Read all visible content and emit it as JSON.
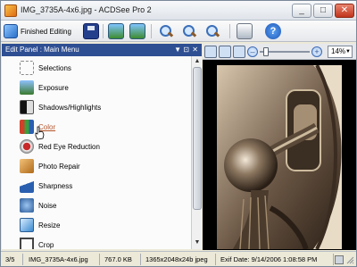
{
  "window": {
    "title": "IMG_3735A-4x6.jpg - ACDSee Pro 2"
  },
  "titlebar": {
    "minimize": "_",
    "maximize": "□",
    "close": "✕"
  },
  "toolbar": {
    "finished_label": "Finished Editing"
  },
  "panel": {
    "title": "Edit Panel : Main Menu",
    "pin": "▼ ⊡",
    "close": "✕"
  },
  "menu": {
    "items": [
      {
        "label": "Selections",
        "icon": "selection-icon",
        "color": "#9a9a9a",
        "link": false
      },
      {
        "label": "Exposure",
        "icon": "exposure-icon",
        "color": "#3a7a2e",
        "link": false
      },
      {
        "label": "Shadows/Highlights",
        "icon": "shadows-highlights-icon",
        "color": "#555555",
        "link": false
      },
      {
        "label": "Color",
        "icon": "color-icon",
        "color": "#d0402a",
        "link": true
      },
      {
        "label": "Red Eye Reduction",
        "icon": "red-eye-icon",
        "color": "#c82828",
        "link": false
      },
      {
        "label": "Photo Repair",
        "icon": "photo-repair-icon",
        "color": "#d08a2a",
        "link": false
      },
      {
        "label": "Sharpness",
        "icon": "sharpness-icon",
        "color": "#2a5fb0",
        "link": false
      },
      {
        "label": "Noise",
        "icon": "noise-icon",
        "color": "#3a78c0",
        "link": false
      },
      {
        "label": "Resize",
        "icon": "resize-icon",
        "color": "#3a8ad0",
        "link": false
      },
      {
        "label": "Crop",
        "icon": "crop-icon",
        "color": "#444444",
        "link": false
      }
    ]
  },
  "viewbar": {
    "zoom_value": "14%",
    "zoom_out": "–",
    "zoom_in": "+"
  },
  "statusbar": {
    "position": "3/5",
    "filename": "IMG_3735A-4x6.jpg",
    "filesize": "767.0 KB",
    "dimensions": "1365x2048x24b jpeg",
    "exif_date": "Exif Date: 9/14/2006 1:08:58 PM"
  }
}
